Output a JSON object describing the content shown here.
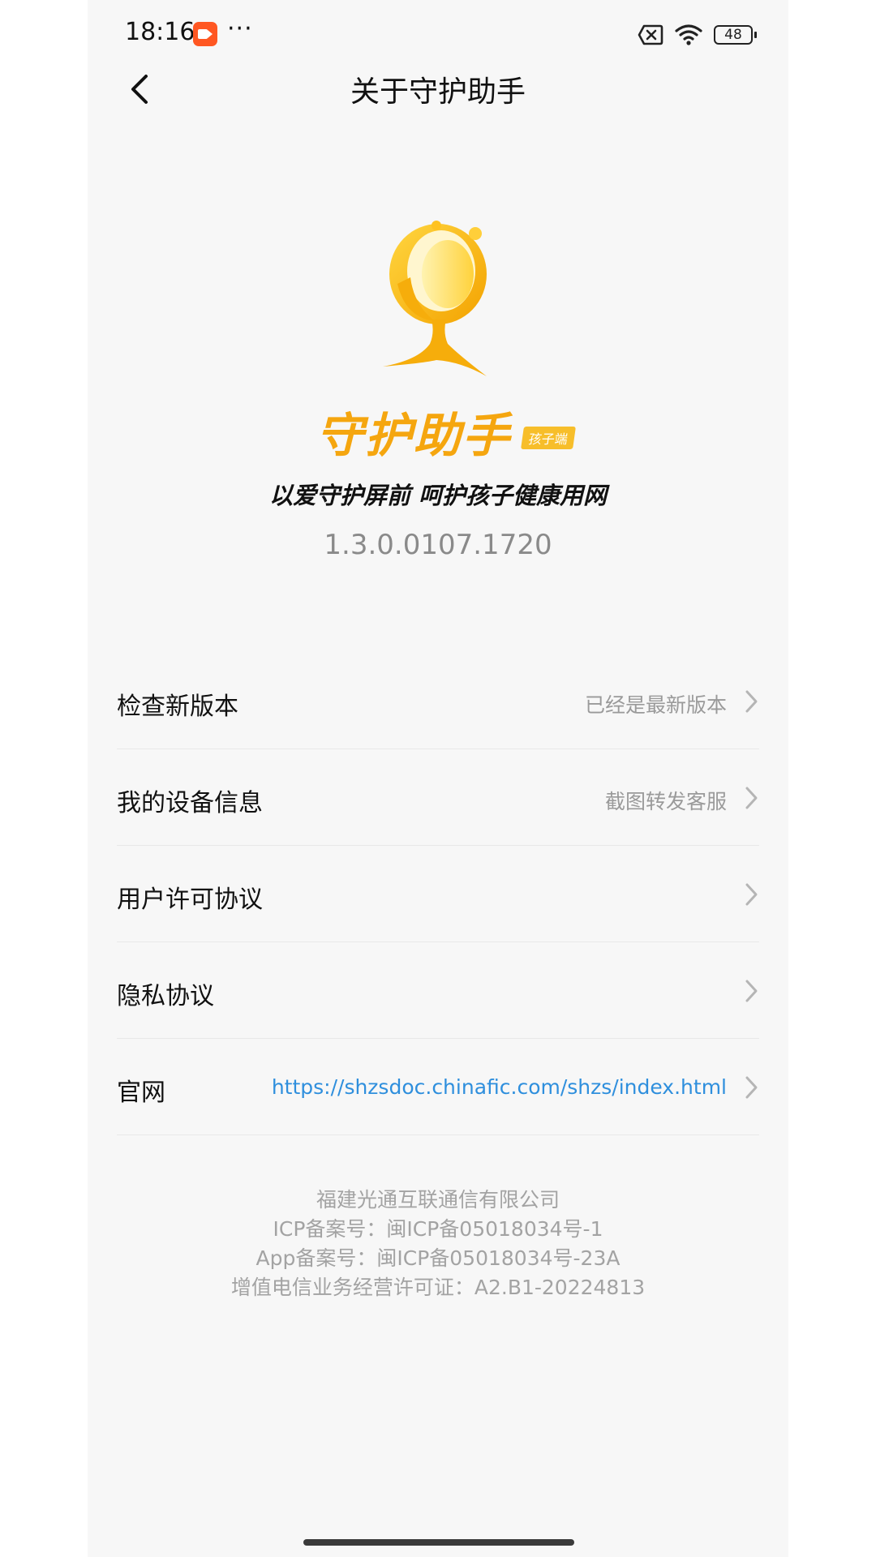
{
  "status_bar": {
    "time": "18:16",
    "more": "···",
    "battery": "48",
    "icons": [
      "screen-record-icon",
      "sim-off-icon",
      "wifi-icon",
      "battery-icon"
    ]
  },
  "header": {
    "title": "关于守护助手",
    "back_icon": "back-arrow-icon"
  },
  "brand": {
    "name": "守护助手",
    "badge": "孩子端",
    "slogan": "以爱守护屏前 呵护孩子健康用网",
    "version": "1.3.0.0107.1720",
    "accent_color": "#f5a60f"
  },
  "menu": {
    "items": [
      {
        "label": "检查新版本",
        "value": "已经是最新版本"
      },
      {
        "label": "我的设备信息",
        "value": "截图转发客服"
      },
      {
        "label": "用户许可协议",
        "value": ""
      },
      {
        "label": "隐私协议",
        "value": ""
      },
      {
        "label": "官网",
        "value": "https://shzsdoc.chinafic.com/shzs/index.html",
        "link_color": "#2f8fdd"
      }
    ]
  },
  "footer": {
    "company": "福建光通互联通信有限公司",
    "icp": "ICP备案号：闽ICP备05018034号-1",
    "app_icp": "App备案号：闽ICP备05018034号-23A",
    "license": "增值电信业务经营许可证：A2.B1-20224813"
  }
}
